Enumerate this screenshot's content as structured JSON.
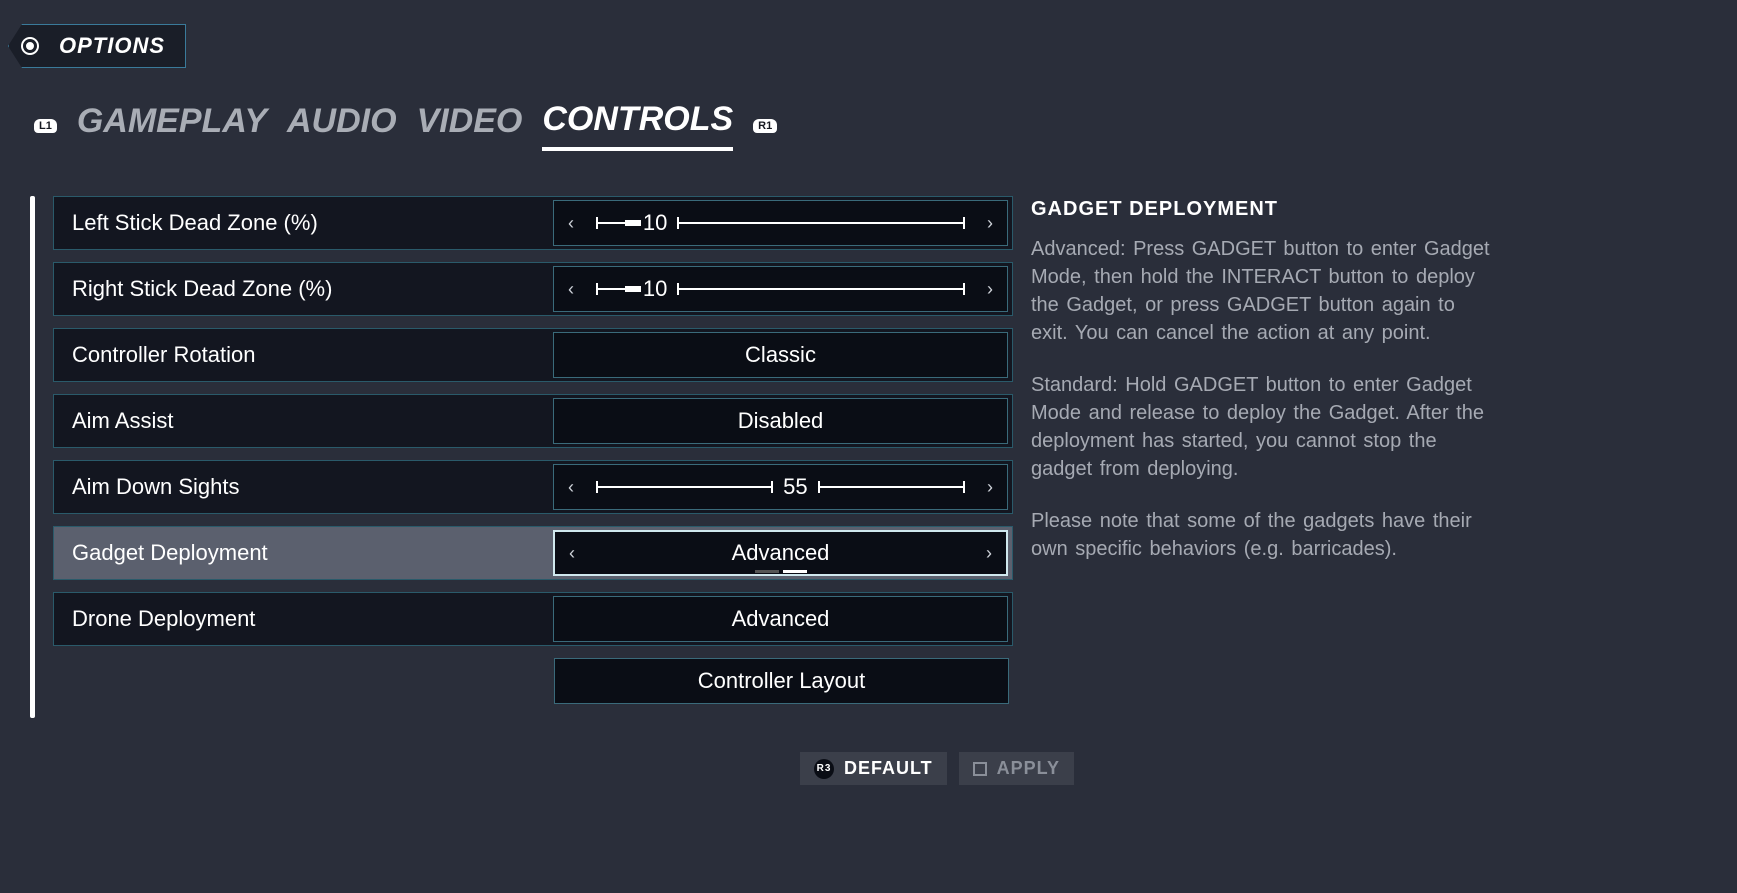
{
  "header": {
    "title": "OPTIONS"
  },
  "bumpers": {
    "left": "L1",
    "right": "R1"
  },
  "tabs": [
    {
      "label": "GAMEPLAY",
      "active": false
    },
    {
      "label": "AUDIO",
      "active": false
    },
    {
      "label": "VIDEO",
      "active": false
    },
    {
      "label": "CONTROLS",
      "active": true
    }
  ],
  "settings": [
    {
      "label": "Left Stick Dead Zone (%)",
      "type": "slider",
      "value": "10",
      "percent": 10
    },
    {
      "label": "Right Stick Dead Zone (%)",
      "type": "slider",
      "value": "10",
      "percent": 10
    },
    {
      "label": "Controller Rotation",
      "type": "select",
      "value": "Classic"
    },
    {
      "label": "Aim Assist",
      "type": "select",
      "value": "Disabled"
    },
    {
      "label": "Aim Down Sights",
      "type": "slider",
      "value": "55",
      "percent": 55
    },
    {
      "label": "Gadget Deployment",
      "type": "select-arrows",
      "value": "Advanced",
      "selected": true
    },
    {
      "label": "Drone Deployment",
      "type": "select",
      "value": "Advanced"
    }
  ],
  "button_row": {
    "label": "Controller Layout"
  },
  "description": {
    "title": "GADGET DEPLOYMENT",
    "p1": "Advanced: Press GADGET button to enter Gadget Mode, then hold the INTERACT button to deploy the Gadget, or press GADGET button again to exit. You can cancel the action at any point.",
    "p2": "Standard: Hold GADGET button to enter Gadget Mode and release to deploy the Gadget. After the deployment has started, you cannot stop the gadget from deploying.",
    "p3": "Please note that some of the gadgets have their own specific behaviors (e.g. barricades)."
  },
  "footer": {
    "default": {
      "icon": "R3",
      "label": "DEFAULT"
    },
    "apply": {
      "icon": "square-icon",
      "label": "APPLY"
    }
  }
}
